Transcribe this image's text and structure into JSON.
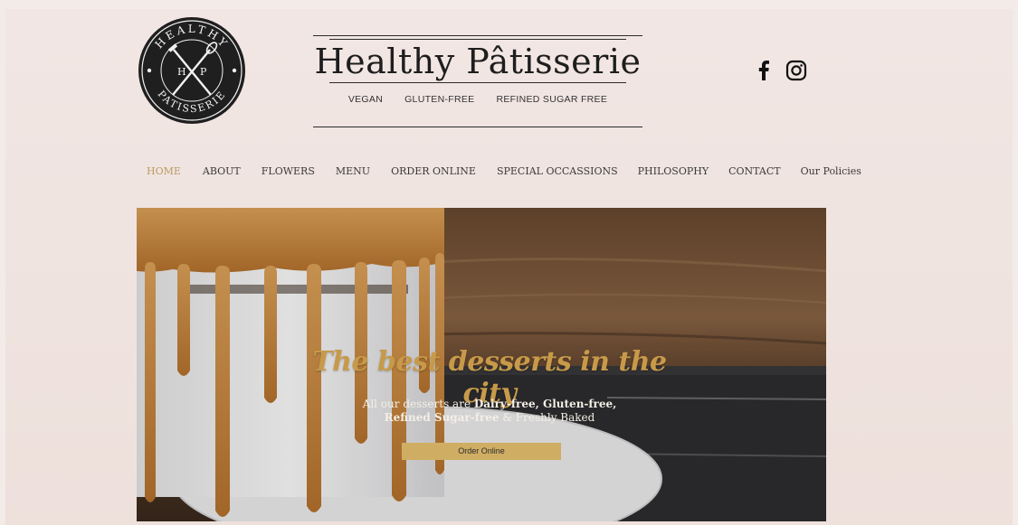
{
  "logo": {
    "ring_text_top": "HEALTHY",
    "ring_text_bottom": "PATISSERIE",
    "left_letter": "H",
    "right_letter": "P"
  },
  "header": {
    "title": "Healthy Pâtisserie",
    "tags": [
      "VEGAN",
      "GLUTEN-FREE",
      "REFINED SUGAR FREE"
    ]
  },
  "social": {
    "icons": [
      "facebook-icon",
      "instagram-icon"
    ]
  },
  "nav": {
    "items": [
      "HOME",
      "ABOUT",
      "FLOWERS",
      "MENU",
      "ORDER ONLINE",
      "SPECIAL OCCASSIONS",
      "PHILOSOPHY",
      "CONTACT",
      "Our Policies"
    ],
    "active": "HOME"
  },
  "hero": {
    "heading": "The best desserts  in the city",
    "subtitle_line1_prefix": "All our desserts are ",
    "subtitle_line1_bold": "Dairy-free, Gluten-free,",
    "subtitle_line2_bold": "Refined Sugar-free",
    "subtitle_line2_suffix": " & Freshly Baked",
    "cta_label": "Order Online"
  },
  "colors": {
    "accent": "#b99b62",
    "cta": "#cfae63",
    "heading_gold": "#c79a4a",
    "background": "#efe3df"
  }
}
